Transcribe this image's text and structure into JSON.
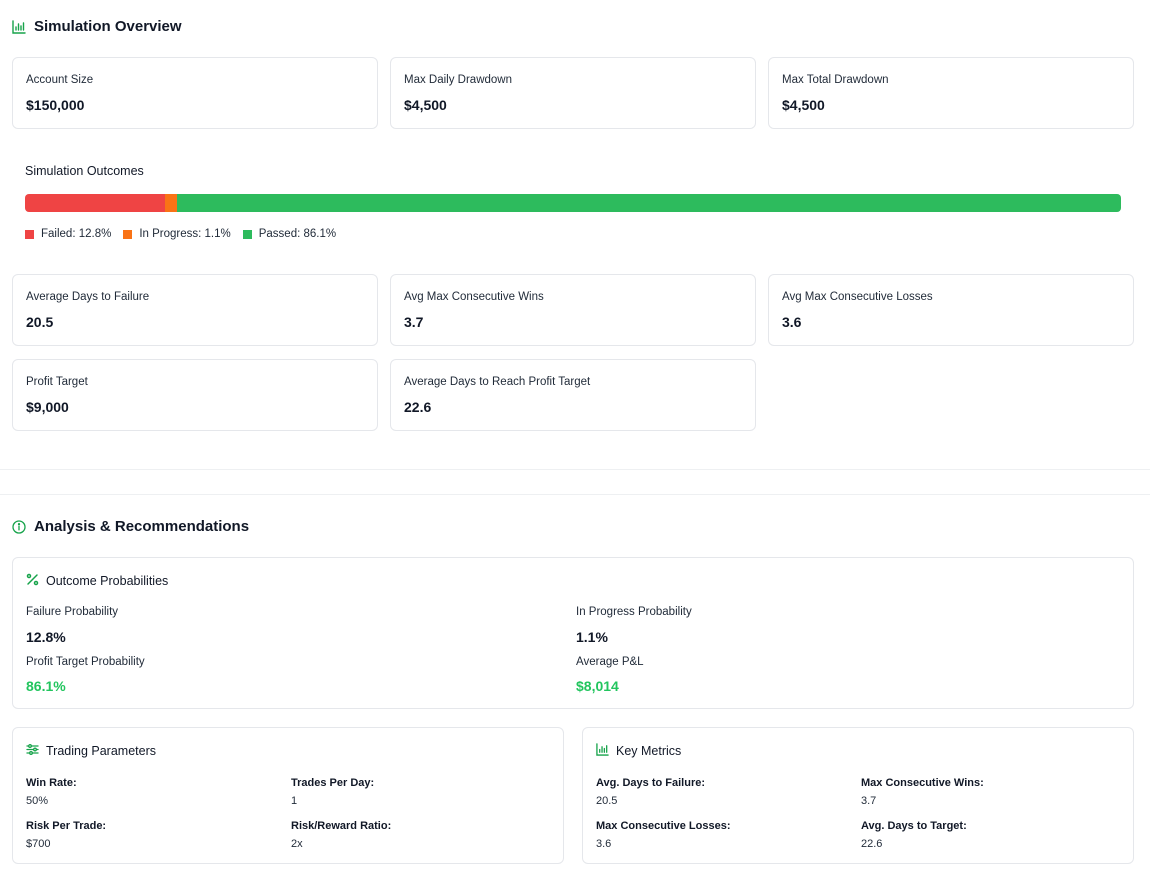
{
  "overview": {
    "title": "Simulation Overview",
    "icon": "bar-chart-icon",
    "cards": [
      {
        "label": "Account Size",
        "value": "$150,000"
      },
      {
        "label": "Max Daily Drawdown",
        "value": "$4,500"
      },
      {
        "label": "Max Total Drawdown",
        "value": "$4,500"
      }
    ]
  },
  "outcomes": {
    "title": "Simulation Outcomes",
    "segments": [
      {
        "name": "failed",
        "label": "Failed: 12.8%",
        "percent": 12.8,
        "color": "#ef4444"
      },
      {
        "name": "in-progress",
        "label": "In Progress: 1.1%",
        "percent": 1.1,
        "color": "#f97316"
      },
      {
        "name": "passed",
        "label": "Passed: 86.1%",
        "percent": 86.1,
        "color": "#2dbb5d"
      }
    ]
  },
  "stats": [
    {
      "label": "Average Days to Failure",
      "value": "20.5"
    },
    {
      "label": "Avg Max Consecutive Wins",
      "value": "3.7"
    },
    {
      "label": "Avg Max Consecutive Losses",
      "value": "3.6"
    },
    {
      "label": "Profit Target",
      "value": "$9,000"
    },
    {
      "label": "Average Days to Reach Profit Target",
      "value": "22.6"
    }
  ],
  "analysis": {
    "title": "Analysis & Recommendations",
    "icon": "info-circle-icon",
    "probabilities": {
      "title": "Outcome Probabilities",
      "icon": "percent-icon",
      "items": [
        {
          "label": "Failure Probability",
          "value": "12.8%"
        },
        {
          "label": "In Progress Probability",
          "value": "1.1%"
        },
        {
          "label": "Profit Target Probability",
          "value": "86.1%"
        },
        {
          "label": "Average P&L",
          "value": "$8,014"
        }
      ]
    },
    "trading_parameters": {
      "title": "Trading Parameters",
      "icon": "sliders-icon",
      "items": [
        {
          "label": "Win Rate:",
          "value": "50%"
        },
        {
          "label": "Trades Per Day:",
          "value": "1"
        },
        {
          "label": "Risk Per Trade:",
          "value": "$700"
        },
        {
          "label": "Risk/Reward Ratio:",
          "value": "2x"
        }
      ]
    },
    "key_metrics": {
      "title": "Key Metrics",
      "icon": "bar-chart-icon",
      "items": [
        {
          "label": "Avg. Days to Failure:",
          "value": "20.5"
        },
        {
          "label": "Max Consecutive Wins:",
          "value": "3.7"
        },
        {
          "label": "Max Consecutive Losses:",
          "value": "3.6"
        },
        {
          "label": "Avg. Days to Target:",
          "value": "22.6"
        }
      ]
    }
  },
  "colors": {
    "accent": "#16a34a",
    "positive": "#22c55e",
    "border": "#e5e7eb"
  }
}
